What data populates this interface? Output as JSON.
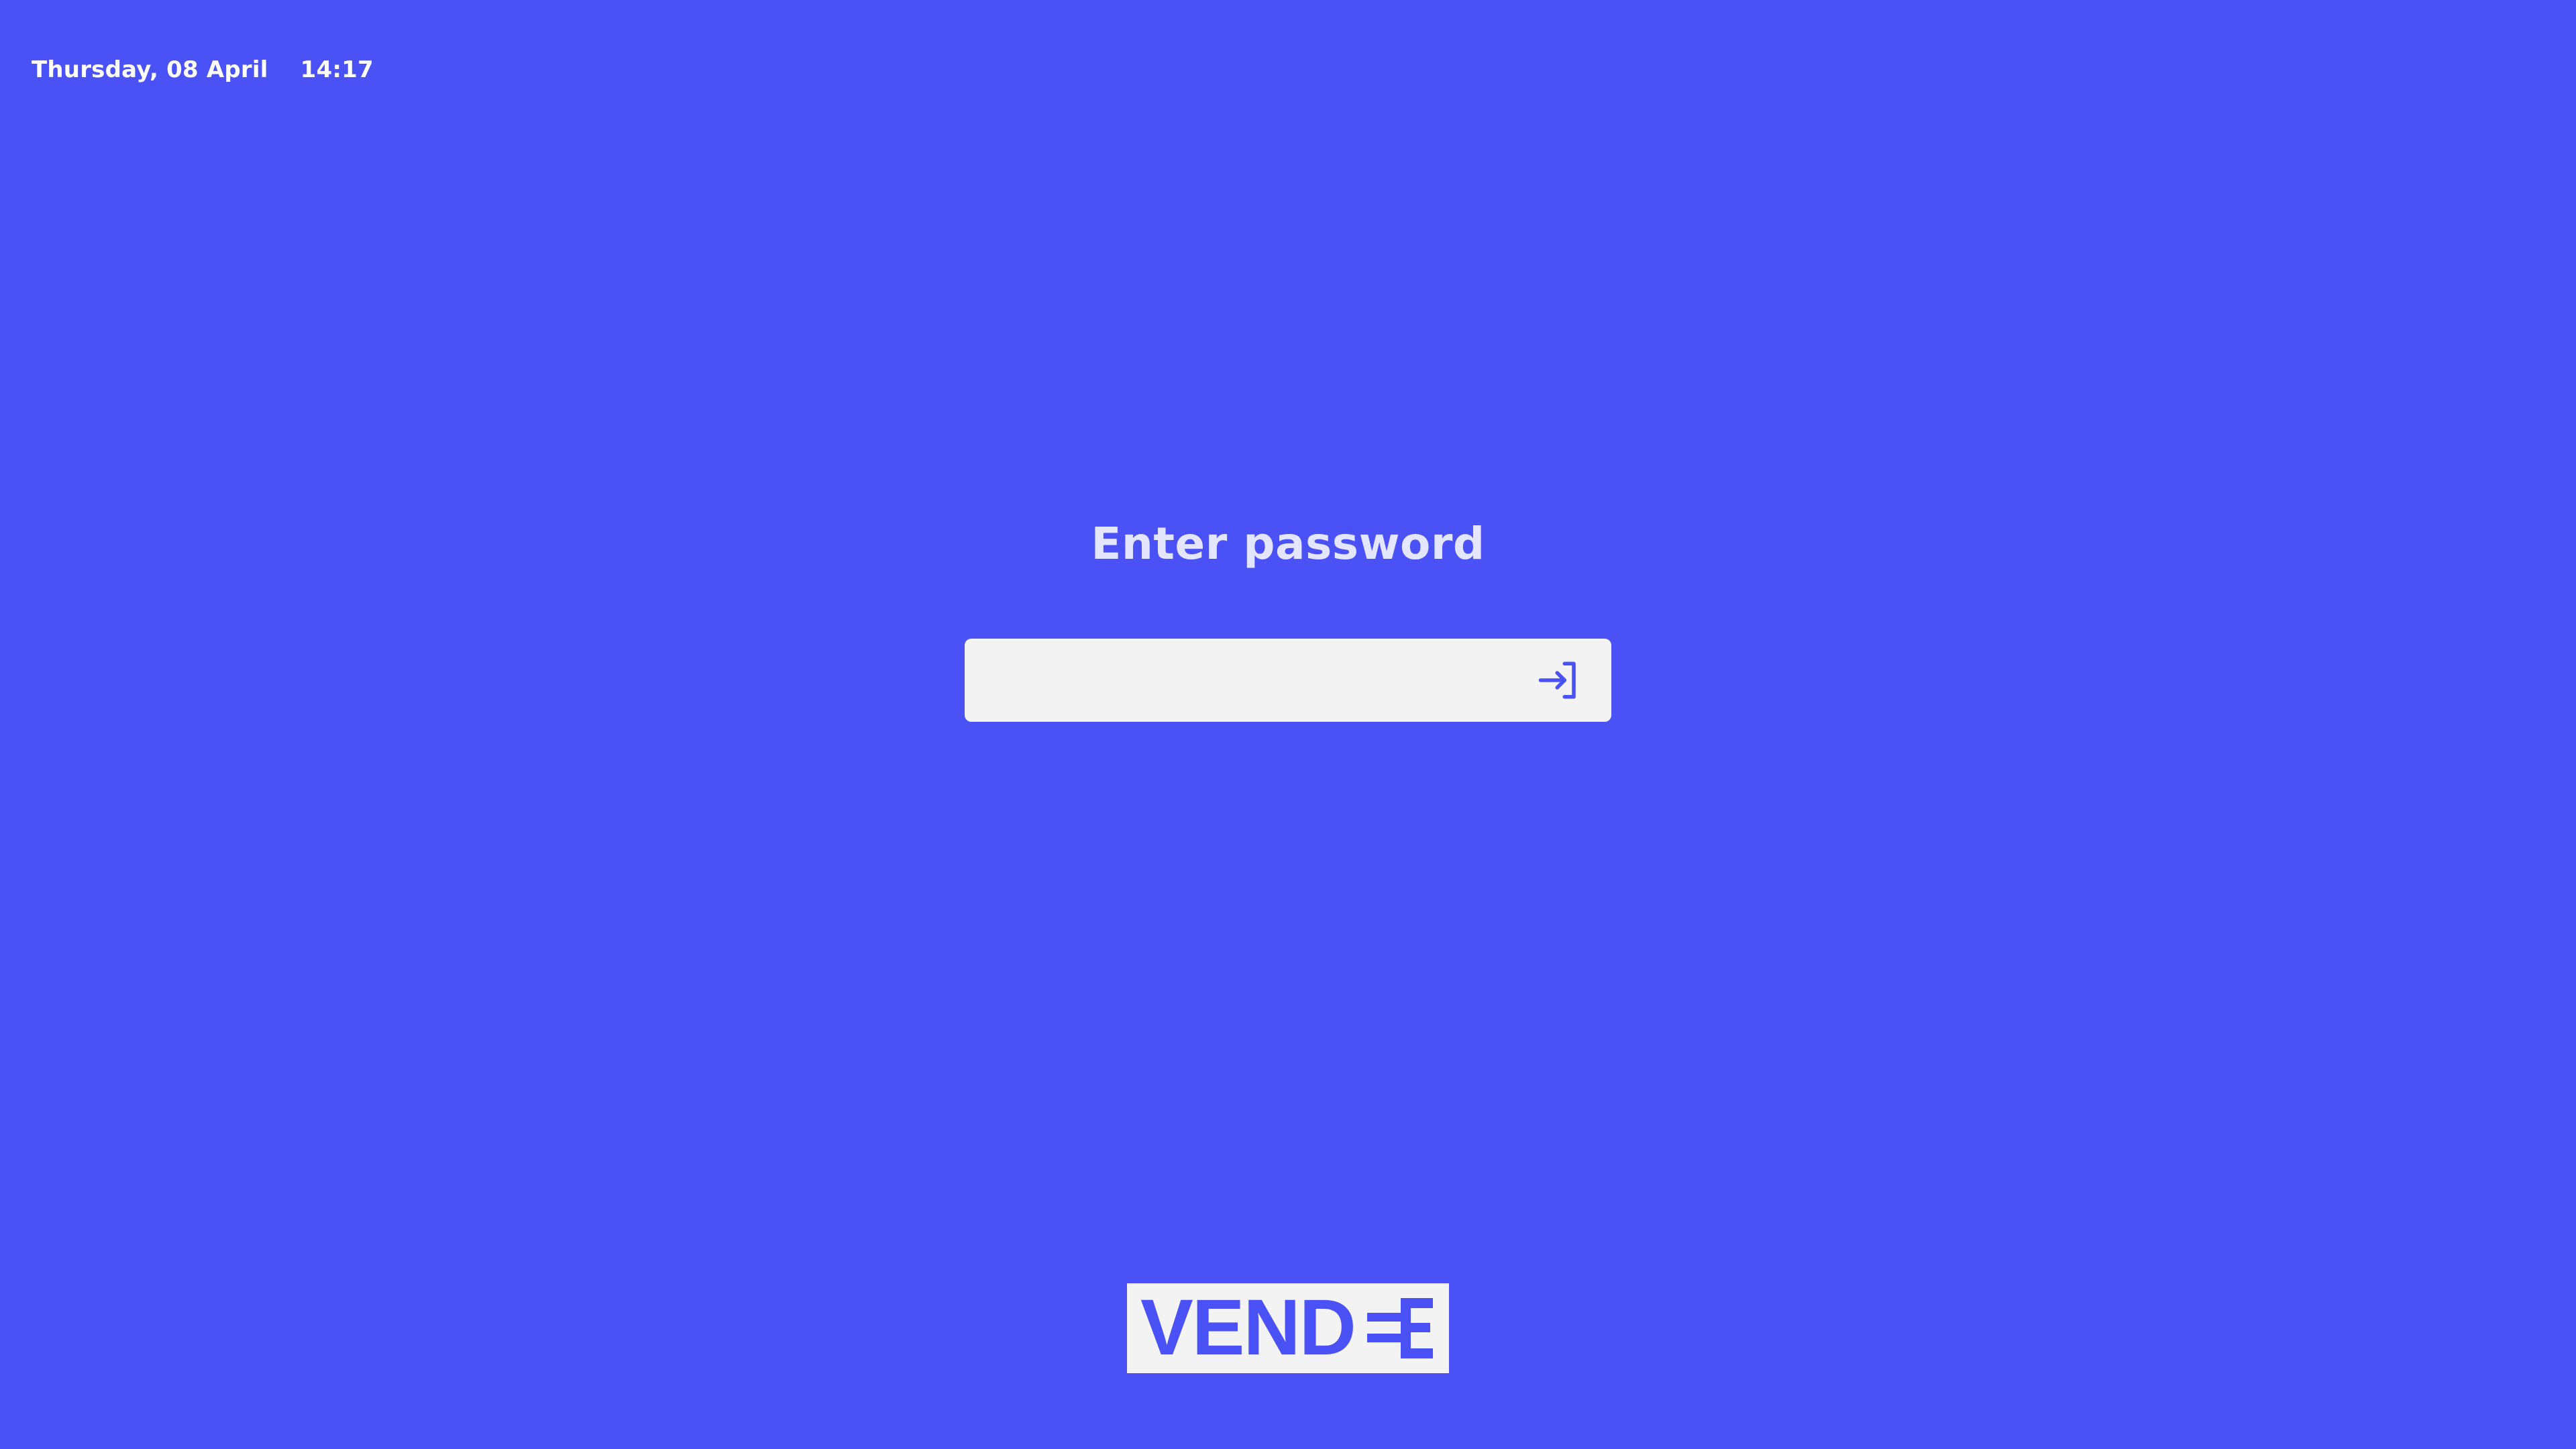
{
  "status_bar": {
    "date": "Thursday, 08 April",
    "time": "14:17"
  },
  "login": {
    "title": "Enter password",
    "password_value": "",
    "password_placeholder": "",
    "submit_icon": "login-arrow-icon"
  },
  "branding": {
    "logo_text": "VENDEE",
    "logo_color": "#4a52f6",
    "logo_background": "#f3f3f3"
  },
  "colors": {
    "background": "#4a52f6",
    "accent": "#4a52f6",
    "title_text": "#e4e5ff",
    "status_text": "#ffffff",
    "input_background": "#f3f3f3"
  }
}
